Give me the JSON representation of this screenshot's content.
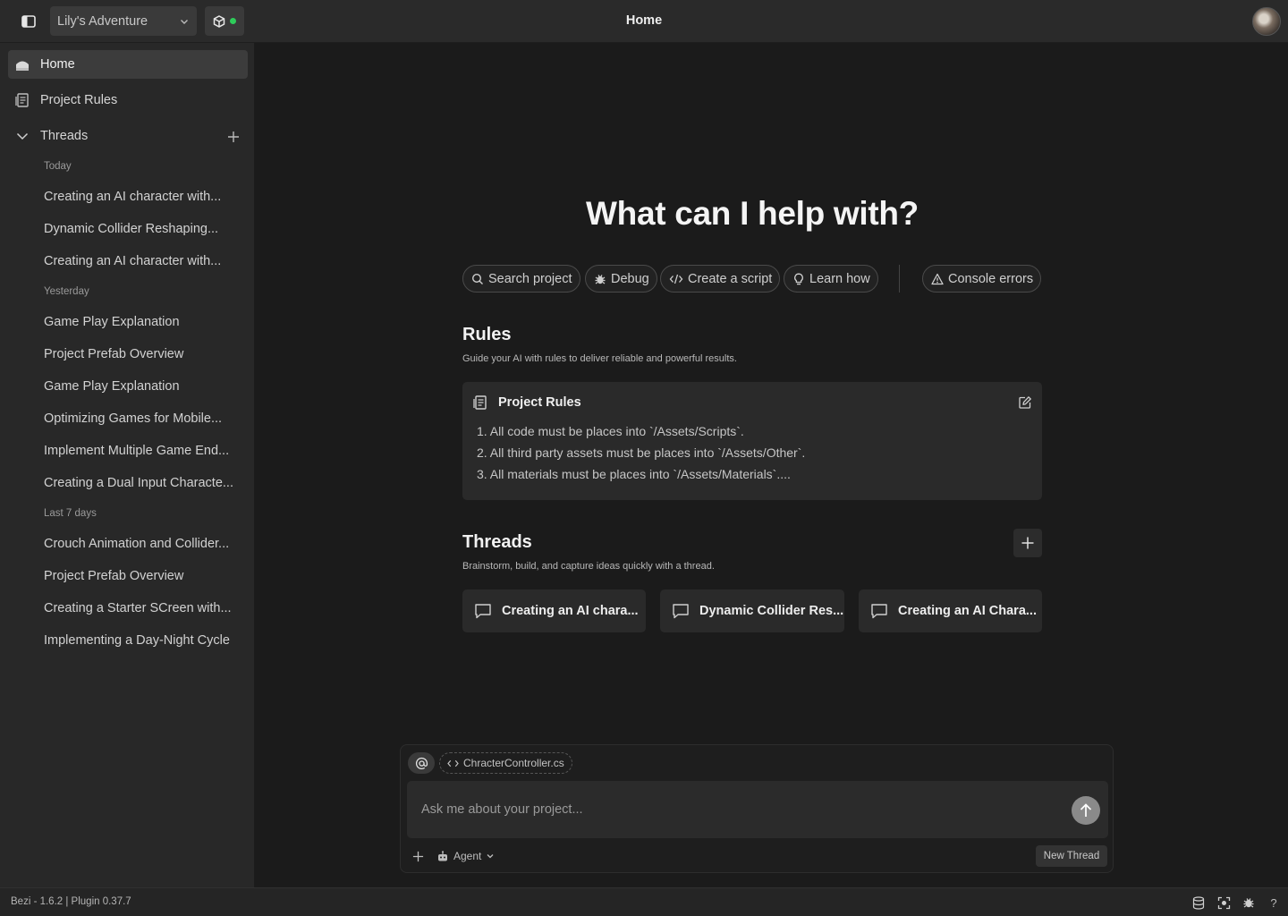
{
  "topbar": {
    "project_name": "Lily's Adventure",
    "title": "Home"
  },
  "sidebar": {
    "home_label": "Home",
    "project_rules_label": "Project Rules",
    "threads_label": "Threads",
    "groups": [
      {
        "label": "Today",
        "items": [
          "Creating an AI character with...",
          "Dynamic Collider Reshaping...",
          "Creating an AI character with..."
        ]
      },
      {
        "label": "Yesterday",
        "items": [
          "Game Play Explanation",
          "Project Prefab Overview",
          "Game Play Explanation",
          "Optimizing Games for Mobile...",
          "Implement Multiple Game End...",
          "Creating a Dual Input Characte..."
        ]
      },
      {
        "label": "Last 7 days",
        "items": [
          "Crouch Animation and Collider...",
          "Project Prefab Overview",
          "Creating a Starter SCreen with...",
          "Implementing a Day-Night Cycle"
        ]
      }
    ]
  },
  "main": {
    "hero": "What can I help with?",
    "chips": [
      "Search project",
      "Debug",
      "Create a script",
      "Learn how",
      "Console errors"
    ],
    "rules": {
      "title": "Rules",
      "subtitle": "Guide your AI with rules to deliver reliable and powerful results.",
      "card_title": "Project Rules",
      "lines": [
        "1. All code must be places into `/Assets/Scripts`.",
        "2. All third party assets must be places into `/Assets/Other`.",
        "3. All materials must be places into `/Assets/Materials`...."
      ]
    },
    "threads": {
      "title": "Threads",
      "subtitle": "Brainstorm, build, and capture ideas quickly with a thread.",
      "cards": [
        "Creating an AI chara...",
        "Dynamic Collider Res...",
        "Creating an AI Chara..."
      ]
    }
  },
  "composer": {
    "file_chip": "ChracterController.cs",
    "placeholder": "Ask me about your project...",
    "mode": "Agent",
    "new_thread_label": "New Thread"
  },
  "statusbar": {
    "version": "Bezi - 1.6.2 | Plugin 0.37.7",
    "help": "?"
  },
  "colors": {
    "background": "#1b1b1b",
    "sidebar": "#282828",
    "card": "#2a2a2a",
    "status_ok": "#2ecc5a"
  }
}
